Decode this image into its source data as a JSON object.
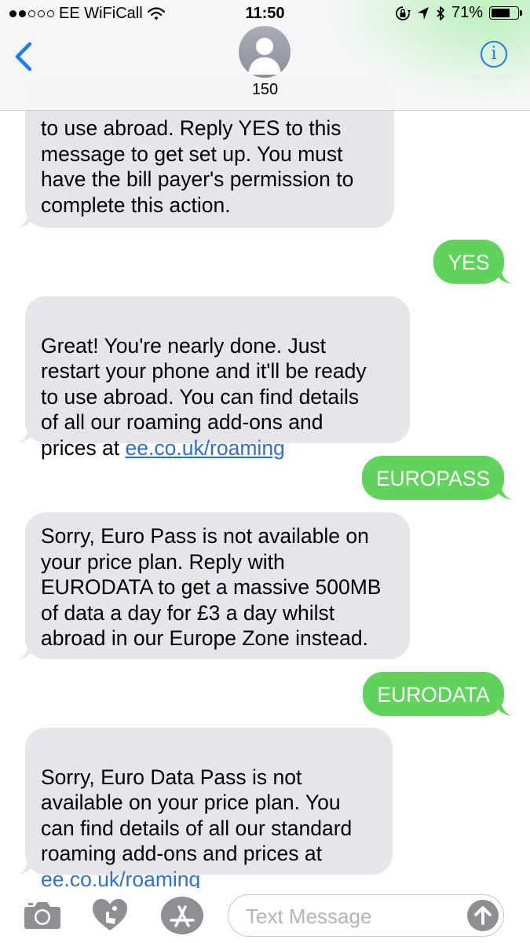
{
  "status_bar": {
    "carrier": "EE WiFiCall",
    "time": "11:50",
    "battery_percent": "71%",
    "battery_level": 0.71,
    "signal_bars_filled": 2,
    "signal_bars_total": 5
  },
  "header": {
    "contact_name": "150",
    "info_label": "i"
  },
  "messages": [
    {
      "direction": "incoming",
      "text": "to use abroad. Reply YES to this\nmessage to get set up. You must\nhave the bill payer's permission to\ncomplete this action.",
      "partial_top": true
    },
    {
      "direction": "outgoing",
      "text": "YES"
    },
    {
      "direction": "incoming",
      "text": "Great! You're nearly done. Just\nrestart your phone and it'll be ready\nto use abroad. You can find details\nof all our roaming add-ons and\nprices at ",
      "link": "ee.co.uk/roaming"
    },
    {
      "direction": "outgoing",
      "text": "EUROPASS"
    },
    {
      "direction": "incoming",
      "text": "Sorry, Euro Pass is not available on\nyour price plan. Reply with\nEURODATA to get a massive 500MB\nof data a day for £3 a day whilst\nabroad in our Europe Zone instead."
    },
    {
      "direction": "outgoing",
      "text": "EURODATA"
    },
    {
      "direction": "incoming",
      "text": "Sorry, Euro Data Pass is not\navailable on your price plan. You\ncan find details of all our standard\nroaming add-ons and prices at\n",
      "link": "ee.co.uk/roaming"
    }
  ],
  "input_bar": {
    "placeholder": "Text Message",
    "icons": [
      "camera-icon",
      "digital-touch-heart-icon",
      "app-store-icon",
      "send-arrow-icon"
    ]
  },
  "colors": {
    "incoming_bubble": "#e5e5ea",
    "outgoing_bubble": "#5fd35a",
    "link": "#2d6fd4",
    "accent": "#1d7cf2"
  }
}
